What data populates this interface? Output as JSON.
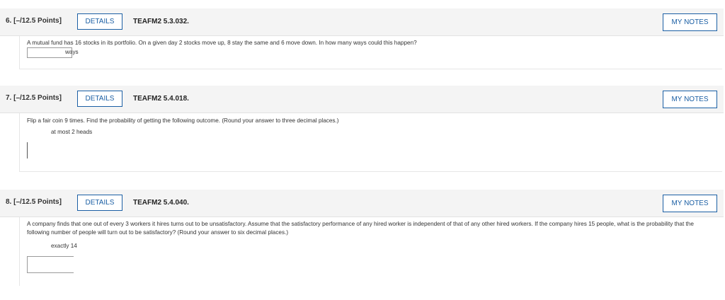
{
  "questions": [
    {
      "number_label": "6.  [–/12.5 Points]",
      "details_label": "DETAILS",
      "code": "TEAFM2 5.3.032.",
      "notes_label": "MY NOTES",
      "text": "A mutual fund has 16 stocks in its portfolio. On a given day 2 stocks move up, 8 stay the same and 6 move down. In how many ways could this happen?",
      "answer_value": "",
      "unit": "ways"
    },
    {
      "number_label": "7.  [–/12.5 Points]",
      "details_label": "DETAILS",
      "code": "TEAFM2 5.4.018.",
      "notes_label": "MY NOTES",
      "text": "Flip a fair coin 9 times. Find the probability of getting the following outcome. (Round your answer to three decimal places.)",
      "sub_label": "at most 2 heads",
      "answer_value": ""
    },
    {
      "number_label": "8.  [–/12.5 Points]",
      "details_label": "DETAILS",
      "code": "TEAFM2 5.4.040.",
      "notes_label": "MY NOTES",
      "text": "A company finds that one out of every 3 workers it hires turns out to be unsatisfactory. Assume that the satisfactory performance of any hired worker is independent of that of any other hired workers. If the company hires 15 people, what is the probability that the following number of people will turn out to be satisfactory? (Round your answer to six decimal places.)",
      "sub_label": "exactly 14",
      "answer_value": ""
    }
  ]
}
